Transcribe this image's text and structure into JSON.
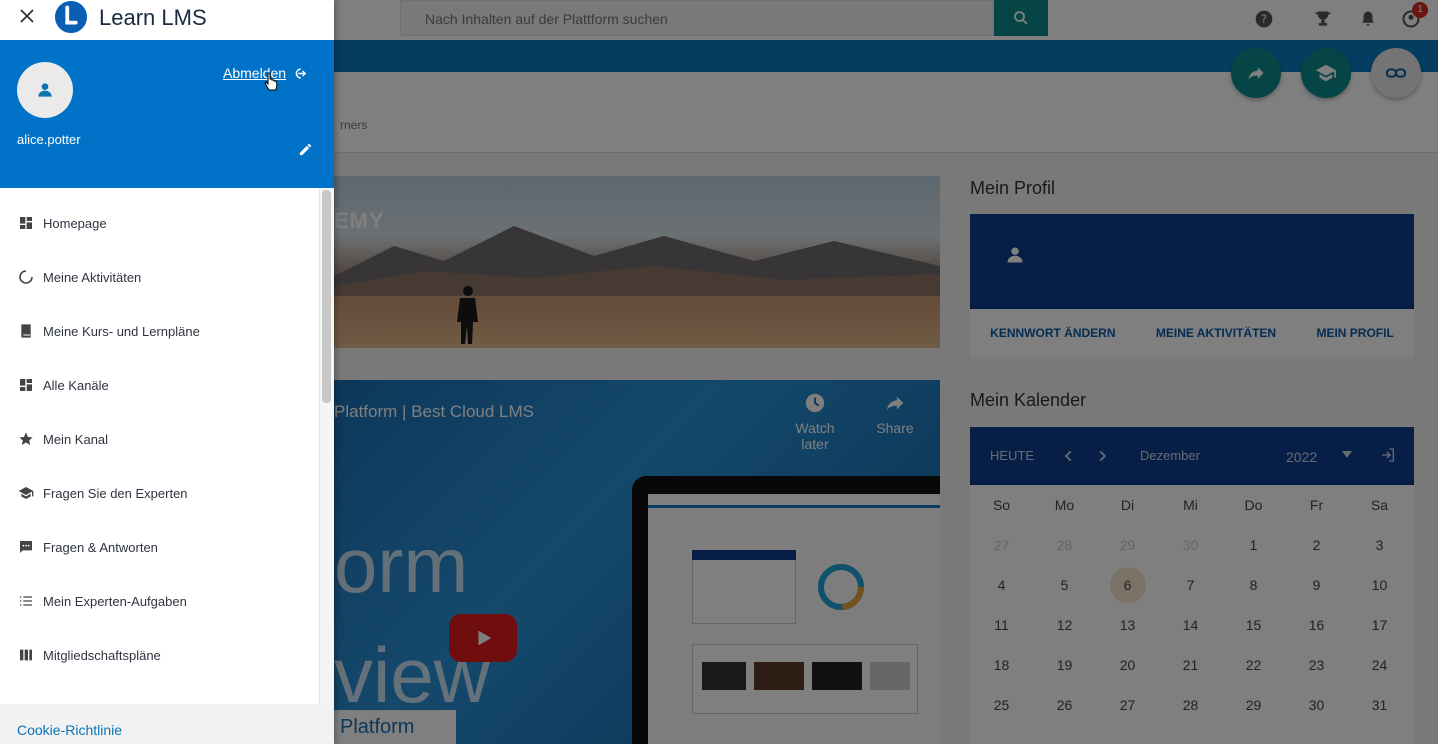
{
  "drawer": {
    "brand": "Learn LMS",
    "user": {
      "name": "alice.potter"
    },
    "logout_label": "Abmelden",
    "menu": [
      {
        "label": "Homepage",
        "icon": "dashboard-icon"
      },
      {
        "label": "Meine Aktivitäten",
        "icon": "activity-icon"
      },
      {
        "label": "Meine Kurs- und Lernpläne",
        "icon": "book-icon"
      },
      {
        "label": "Alle Kanäle",
        "icon": "channels-icon"
      },
      {
        "label": "Mein Kanal",
        "icon": "star-icon"
      },
      {
        "label": "Fragen Sie den Experten",
        "icon": "school-icon"
      },
      {
        "label": "Fragen & Antworten",
        "icon": "chat-icon"
      },
      {
        "label": "Mein Experten-Aufgaben",
        "icon": "list-icon"
      },
      {
        "label": "Mitgliedschaftspläne",
        "icon": "columns-icon"
      }
    ],
    "cookie_link": "Cookie-Richtlinie"
  },
  "header": {
    "search_placeholder": "Nach Inhalten auf der Plattform suchen",
    "notification_count": "1"
  },
  "breadcrumb": "rners",
  "banner_text": "EMY",
  "video": {
    "title": "Platform | Best Cloud LMS",
    "watch_later": "Watch later",
    "share": "Share",
    "big_line1": "orm",
    "big_line2": "view",
    "bottom_label": "Platform"
  },
  "profile": {
    "heading": "Mein Profil",
    "links": [
      "KENNWORT ÄNDERN",
      "MEINE AKTIVITÄTEN",
      "MEIN PROFIL"
    ]
  },
  "calendar": {
    "heading": "Mein Kalender",
    "today_label": "HEUTE",
    "month": "Dezember",
    "year": "2022",
    "weekdays": [
      "So",
      "Mo",
      "Di",
      "Mi",
      "Do",
      "Fr",
      "Sa"
    ],
    "weeks": [
      [
        "27",
        "28",
        "29",
        "30",
        "1",
        "2",
        "3"
      ],
      [
        "4",
        "5",
        "6",
        "7",
        "8",
        "9",
        "10"
      ],
      [
        "11",
        "12",
        "13",
        "14",
        "15",
        "16",
        "17"
      ],
      [
        "18",
        "19",
        "20",
        "21",
        "22",
        "23",
        "24"
      ],
      [
        "25",
        "26",
        "27",
        "28",
        "29",
        "30",
        "31"
      ]
    ],
    "today": "6"
  },
  "colors": {
    "drawer_blue": "#0073c8",
    "navy": "#0e3c8c",
    "teal": "#0b8a8c",
    "link": "#0a74b3"
  }
}
